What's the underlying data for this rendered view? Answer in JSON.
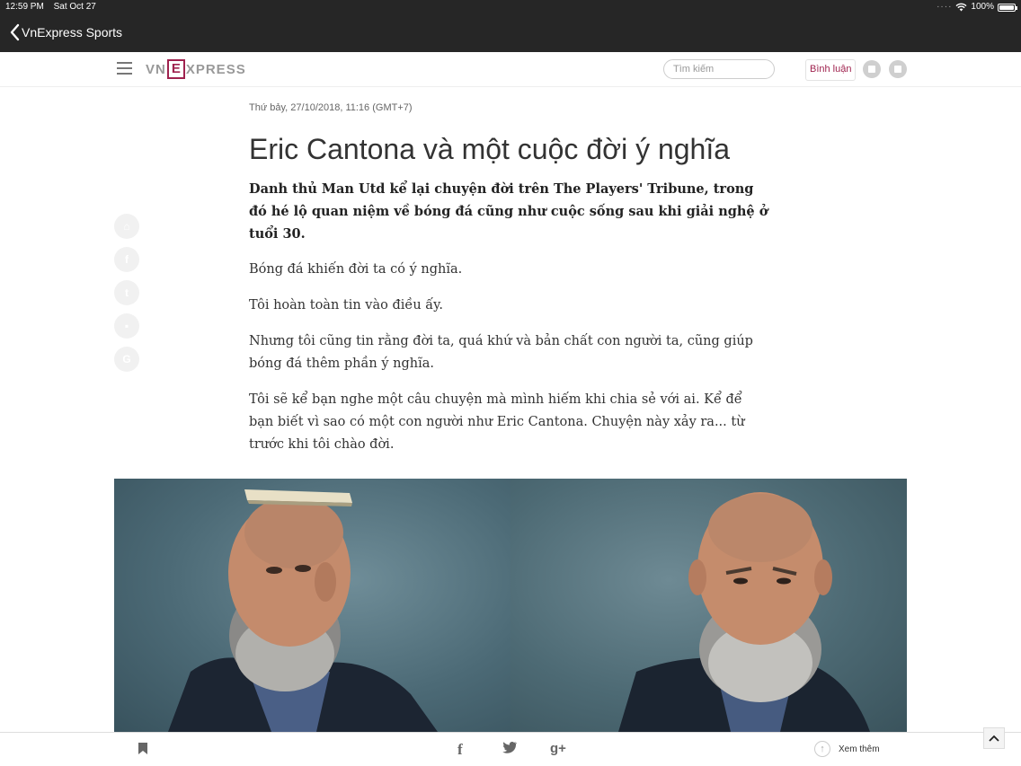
{
  "status_bar": {
    "time": "12:59 PM",
    "date": "Sat Oct 27",
    "battery": "100%"
  },
  "app_bar": {
    "back_label": "VnExpress Sports"
  },
  "site_header": {
    "logo_left": "VN",
    "logo_box": "E",
    "logo_right": "XPRESS",
    "search_placeholder": "Tìm kiếm",
    "comment_label": "Bình luận"
  },
  "article": {
    "date": "Thứ bảy, 27/10/2018, 11:16 (GMT+7)",
    "title": "Eric Cantona và một cuộc đời ý nghĩa",
    "lead": "Danh thủ Man Utd kể lại chuyện đời trên The Players' Tribune, trong đó hé lộ quan niệm về bóng đá cũng như cuộc sống sau khi giải nghệ ở tuổi 30.",
    "paragraphs": [
      "Bóng đá khiến đời ta có ý nghĩa.",
      "Tôi hoàn toàn tin vào điều ấy.",
      "Nhưng tôi cũng tin rằng đời ta, quá khứ và bản chất con người ta, cũng giúp bóng đá thêm phần ý nghĩa.",
      "Tôi sẽ kể bạn nghe một câu chuyện mà mình hiếm khi chia sẻ với ai. Kể để bạn biết vì sao có một con người như Eric Cantona. Chuyện này xảy ra... từ trước khi tôi chào đời."
    ]
  },
  "share_sidebar": [
    "home-icon",
    "facebook-icon",
    "twitter-icon",
    "comment-icon",
    "google-plus-icon"
  ],
  "bottom_bar": {
    "more_label": "Xem thêm"
  },
  "colors": {
    "brand": "#9f224e",
    "bar_dark": "#262626"
  }
}
